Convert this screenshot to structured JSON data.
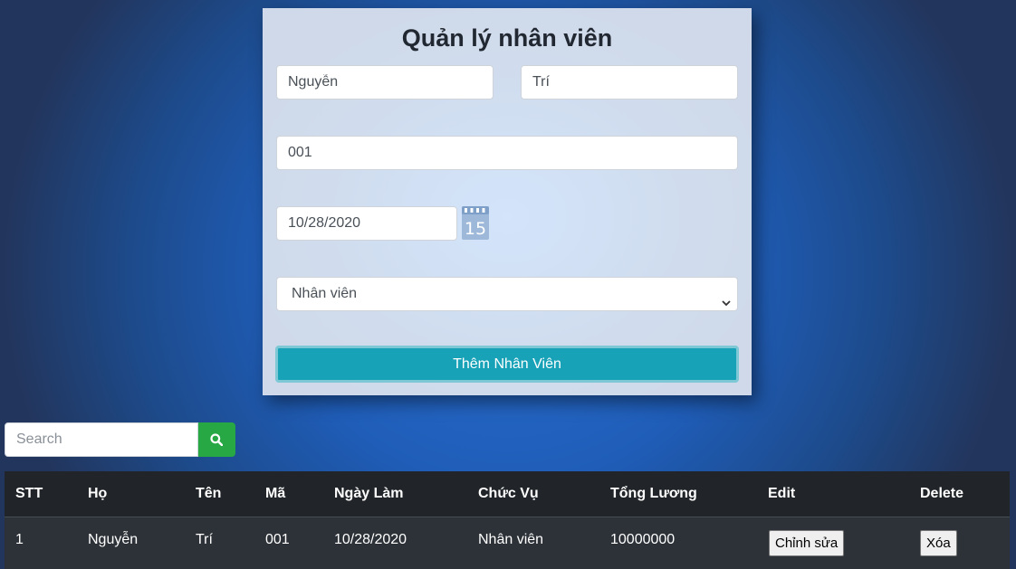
{
  "form": {
    "title": "Quản lý nhân viên",
    "last_name_value": "Nguyễn",
    "first_name_value": "Trí",
    "code_value": "001",
    "date_value": "10/28/2020",
    "calendar_day": "15",
    "position_selected": "Nhân viên",
    "submit_label": "Thêm Nhân Viên"
  },
  "search": {
    "placeholder": "Search",
    "icon": "search-icon"
  },
  "table": {
    "headers": [
      "STT",
      "Họ",
      "Tên",
      "Mã",
      "Ngày Làm",
      "Chức Vụ",
      "Tổng Lương",
      "Edit",
      "Delete"
    ],
    "rows": [
      {
        "stt": "1",
        "ho": "Nguyễn",
        "ten": "Trí",
        "ma": "001",
        "ngay_lam": "10/28/2020",
        "chuc_vu": "Nhân viên",
        "tong_luong": "10000000",
        "edit_label": "Chỉnh sửa",
        "delete_label": "Xóa"
      }
    ]
  },
  "colors": {
    "accent_button": "#17a2b8",
    "search_button": "#28a745",
    "table_header": "#212529",
    "table_body": "#343a40"
  }
}
